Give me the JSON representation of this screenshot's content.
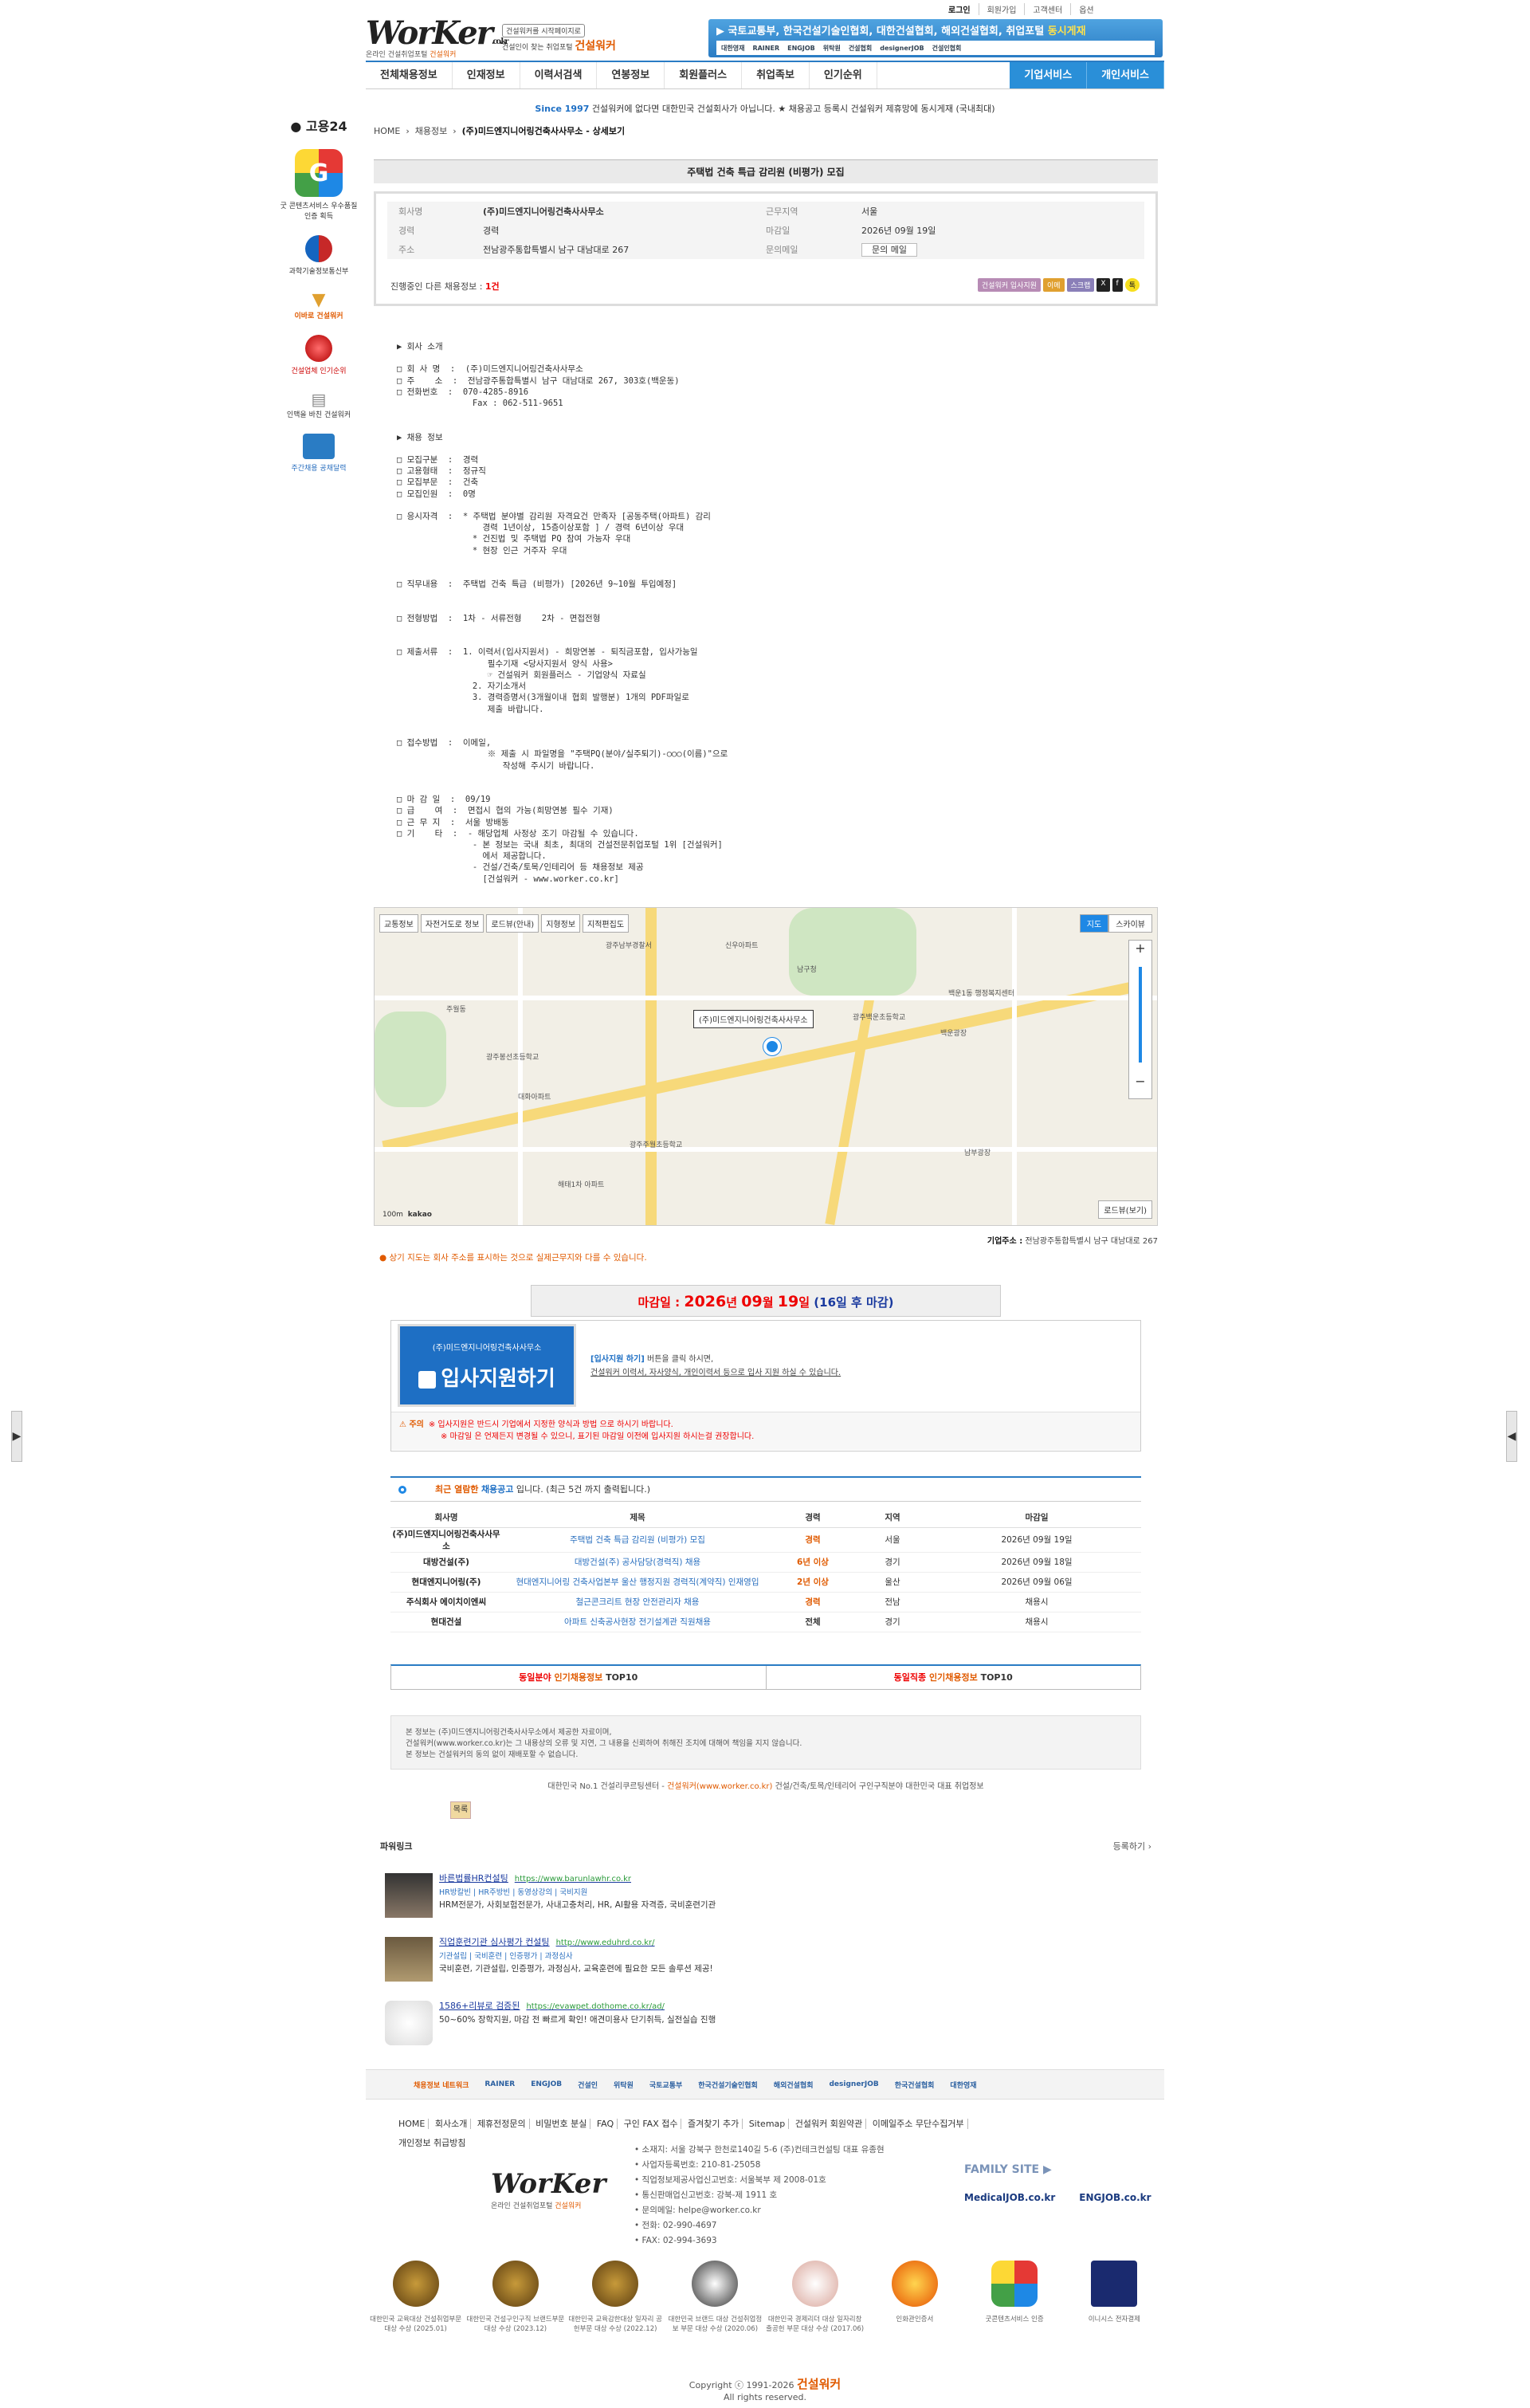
{
  "top_links": [
    "로그인",
    "회원가입",
    "고객센터",
    "옵션"
  ],
  "logo": {
    "text": "WorKer",
    "suffix": ".co.kr",
    "sub1": "온라인 건설취업포털",
    "sub2": "건설워커"
  },
  "slogan": {
    "box": "건설워커를 시작페이지로",
    "line": "건설인이 찾는 취업포털",
    "brand": "건설워커"
  },
  "banner": {
    "text": "국토교통부, 한국건설기술인협회, 대한건설협회, 해외건설협회, 취업포털",
    "highlight": "동시게재",
    "logos": [
      "대한영재",
      "RAINER",
      "ENGJOB",
      "위탁원",
      "건설협회",
      "designerJOB",
      "건설인협회"
    ]
  },
  "nav": [
    "전체채용정보",
    "인재정보",
    "이력서검색",
    "연봉정보",
    "회원플러스",
    "취업족보",
    "인기순위",
    "기업서비스",
    "개인서비스"
  ],
  "notice": {
    "since": "Since 1997",
    "text": "건설워커에 없다면 대한민국 건설회사가 아닙니다. ★ 채용공고 등록시 건설워커 제휴망에 동시게재 (국내최대)"
  },
  "left": {
    "goyong": "고용24",
    "badge_caption": "굿 콘텐츠서비스 우수품질인증 획득",
    "ministry": "과학기술정보통신부",
    "items": [
      "이바로 건설워커",
      "건설업체 인기순위",
      "인맥을 바친 건설워커",
      "주간채용 공채달력"
    ]
  },
  "breadcrumb": {
    "home": "HOME",
    "mid": "채용정보",
    "cur": "(주)미드엔지니어링건축사사무소 - 상세보기"
  },
  "job": {
    "title": "주택법 건축 특급 감리원 (비평가) 모집",
    "company_k": "회사명",
    "company": "(주)미드엔지니어링건축사사무소",
    "region_k": "근무지역",
    "region": "서울",
    "career_k": "경력",
    "career": "경력",
    "deadline_k": "마감일",
    "deadline": "2026년 09월 19일",
    "addr_k": "주소",
    "addr": "전남광주통합특별시 남구 대남대로 267",
    "contact_k": "문의메일",
    "contact": "문의 메일",
    "more": "진행중인 다른 채용정보 :",
    "more_count": "1건",
    "buttons": [
      "건설워커 입사지원",
      "이메",
      "스크랩",
      "X",
      "f",
      "톡"
    ]
  },
  "body_text": "▶ 회사 소개\n\n□ 회 사 명  :  (주)미드엔지니어링건축사사무소\n□ 주    소  :  전남광주통합특별시 남구 대남대로 267, 303호(백운동)\n□ 전화번호  :  070-4285-8916\n               Fax : 062-511-9651\n\n\n▶ 채용 정보\n\n□ 모집구분  :  경력\n□ 고용형태  :  정규직\n□ 모집부문  :  건축\n□ 모집인원  :  0명\n\n□ 응시자격  :  * 주택법 분야별 감리원 자격요건 만족자 [공동주택(아파트) 감리\n                 경력 1년이상, 15층이상포함 ] / 경력 6년이상 우대\n               * 건진법 및 주택법 PQ 참여 가능자 우대\n               * 현장 인근 거주자 우대\n\n\n□ 직무내용  :  주택법 건축 특급 (비평가) [2026년 9~10월 투입예정]\n\n\n□ 전형방법  :  1차 - 서류전형    2차 - 면접전형\n\n\n□ 제출서류  :  1. 이력서(입사지원서) - 희망연봉 - 퇴직금포함, 입사가능일\n                  필수기재 <당사지원서 양식 사용>\n                  ☞ 건설워커 회원플러스 - 기업양식 자료실\n               2. 자기소개서\n               3. 경력증명서(3개월이내 협회 발행분) 1개의 PDF파일로\n                  제출 바랍니다.\n\n\n□ 접수방법  :  이메일,\n                  ※ 제출 시 파일명을 \"주택PQ(분야/실주퇴기)-○○○(이름)\"으로\n                     작성해 주시기 바랍니다.\n\n\n□ 마 감 일  :  09/19\n□ 급    여  :  면접시 협의 가능(희망연봉 필수 기재)\n□ 근 무 지  :  서울 방배동\n□ 기    타  :  - 해당업체 사정상 조기 마감될 수 있습니다.\n               - 본 정보는 국내 최초, 최대의 건설전문취업포털 1위 [건설워커]\n                 에서 제공합니다.\n               - 건설/건축/토목/인테리어 등 채용정보 제공\n                 [건설워커 - www.worker.co.kr]",
  "map": {
    "tabs": [
      "교통정보",
      "자전거도로 정보",
      "로드뷰(안내)",
      "지형정보",
      "지적편집도"
    ],
    "view": [
      "지도",
      "스카이뷰"
    ],
    "pin_label": "(주)미드엔지니어링건축사사무소",
    "road_view": "로드뷰(보기)",
    "scale": "100m",
    "brand": "kakao",
    "labels": [
      "광주남부경찰서",
      "광주백운초등학교",
      "남구청",
      "백운광장",
      "광주봉선초등학교",
      "대화아파트",
      "남부광장",
      "주월동",
      "신우아파트",
      "광주주월초등학교",
      "백운1동 행정복지센터",
      "해태1차 아파트"
    ]
  },
  "addr_line": {
    "k": "기업주소 :",
    "v": "전남광주통합특별시 남구 대남대로 267"
  },
  "map_note": "상기 지도는 회사 주소를 표시하는 것으로 실제근무지와 다를 수 있습니다.",
  "deadline_box": {
    "pre": "마감일 :",
    "year": "2026",
    "y": "년",
    "month": "09",
    "m": "월",
    "day": "19",
    "d": "일",
    "remain": "(16일 후 마감)"
  },
  "apply": {
    "company": "(주)미드엔지니어링건축사사무소",
    "button": "입사지원하기",
    "line1_b": "[입사지원 하기]",
    "line1": "버튼을 클릭 하시면,",
    "line2": "건설워커 이력서, 자사양식, 개인이력서 등으로 입사 지원 하실 수 있습니다.",
    "warn_t": "주의",
    "warn1": "※ 입사지원은 반드시 기업에서 지정한 양식과 방법 으로 하시기 바랍니다.",
    "warn2": "※ 마감일 은 언제든지 변경될 수 있으니, 표기된 마감일 이전에 입사지원 하시는걸 권장합니다."
  },
  "recent": {
    "pre": "최근 열람한",
    "b": "채용공고",
    "post": "입니다.  (최근 5건 까지 출력됩니다.)",
    "headers": [
      "회사명",
      "제목",
      "경력",
      "지역",
      "마감일"
    ],
    "rows": [
      [
        "(주)미드엔지니어링건축사사무소",
        "주택법 건축 특급 감리원 (비평가) 모집",
        "경력",
        "서울",
        "2026년 09월 19일"
      ],
      [
        "대방건설(주)",
        "대방건설(주) 공사담당(경력직) 채용",
        "6년 이상",
        "경기",
        "2026년 09월 18일"
      ],
      [
        "현대엔지니어링(주)",
        "현대엔지니어링 건축사업본부 울산 행정지원 경력직(계약직) 인재영입",
        "2년 이상",
        "울산",
        "2026년 09월 06일"
      ],
      [
        "주식회사 에이치이엔씨",
        "철근콘크리트 현장 안전관리자 채용",
        "경력",
        "전남",
        "채용시"
      ],
      [
        "현대건설",
        "아파트 신축공사현장 전기설계관 직원채용",
        "전체",
        "경기",
        "채용시"
      ]
    ]
  },
  "top10": [
    {
      "a": "동일분야",
      "b": "인기채용정보",
      "c": "TOP10"
    },
    {
      "a": "동일직종",
      "b": "인기채용정보",
      "c": "TOP10"
    }
  ],
  "disclaimer": [
    "본 정보는 (주)미드엔지니어링건축사사무소에서 제공한 자료이며,",
    "건설워커(www.worker.co.kr)는 그 내용상의 오류 및 지연, 그 내용을 신뢰하여 취해진 조치에 대해여 책임을 지지 않습니다.",
    "본 정보는 건설워커의 동의 없이 재배포할 수 없습니다."
  ],
  "copyline": {
    "pre": "대한민국 No.1 건설리쿠르팅센터 -",
    "brand": "건설워커(www.worker.co.kr)",
    "post": "건설/건축/토목/인테리어 구인구직분야 대한민국 대표 취업정보"
  },
  "list_btn": "목록",
  "powerlink": {
    "title": "파워링크",
    "register": "등록하기 ›",
    "ads": [
      {
        "title": "바른법률HR컨설팅",
        "url": "https://www.barunlawhr.co.kr",
        "tags": "HR방칼빈 | HR주방빈 | 동영상강의 | 국비지원",
        "desc": "HRM전문가, 사회보험전문가, 사내고충처리, HR, AI활용 자격증, 국비훈련기관"
      },
      {
        "title": "직업훈련기관 심사평가 컨설팅",
        "url": "http://www.eduhrd.co.kr/",
        "tags": "기관설립 | 국비훈련 | 인증평가 | 과정심사",
        "desc": "국비훈련, 기관설립, 인증평가, 과정심사, 교육훈련에 필요한 모든 솔루션 제공!"
      },
      {
        "title": "1586+리뷰로 검증된",
        "url": "https://evawpet.dothome.co.kr/ad/",
        "tags": "",
        "desc": "50~60% 장학지원, 마감 전 빠르게 확인! 애견미용사 단기취득, 실전실습 진행"
      }
    ]
  },
  "partners": [
    "채용정보 네트워크",
    "RAINER",
    "ENGJOB",
    "건설인",
    "위탁원",
    "국토교통부",
    "한국건설기술인협회",
    "해외건설협회",
    "designerJOB",
    "한국건설협회",
    "대한영재"
  ],
  "footer": {
    "links": [
      "HOME",
      "회사소개",
      "제휴전정문의",
      "비밀번호 분실",
      "FAQ",
      "구인 FAX 접수",
      "즐겨찾기 추가",
      "Sitemap",
      "건설워커 회원약관",
      "이메일주소 무단수집거부"
    ],
    "privacy": "개인정보 취급방침",
    "info": [
      "소재지: 서울 강북구 한천로140길 5-6 (주)컨테크컨설팅 대표 유종현",
      "사업자등록번호: 210-81-25058",
      "직업정보제공사업신고번호: 서울북부 제 2008-01호",
      "통신판매업신고번호: 강북-제 1911 호",
      "문의메일: helpe@worker.co.kr",
      "전화: 02-990-4697",
      "FAX: 02-994-3693"
    ],
    "family": "FAMILY SITE ▶",
    "family_sites": [
      "MedicalJOB.co.kr",
      "ENGJOB.co.kr"
    ],
    "awards": [
      "대한민국 교육대상 건설취업부문 대상 수상 (2025.01)",
      "대한민국 건설구인구직 브랜드부문 대상 수상 (2023.12)",
      "대한민국 교육감한대상 일자리 공헌부문 대상 수상 (2022.12)",
      "대한민국 브랜드 대상 건설취업정보 부문 대상 수상 (2020.06)",
      "대한민국 경제리더 대상 일자리창출공헌 부문 대상 수상 (2017.06)",
      "인화관인증서",
      "굿콘텐츠서비스 인증",
      "이니시스 전자결제"
    ],
    "copy": "Copyright ⓒ 1991-2026",
    "brand": "건설워커",
    "rights": "All rights reserved."
  }
}
